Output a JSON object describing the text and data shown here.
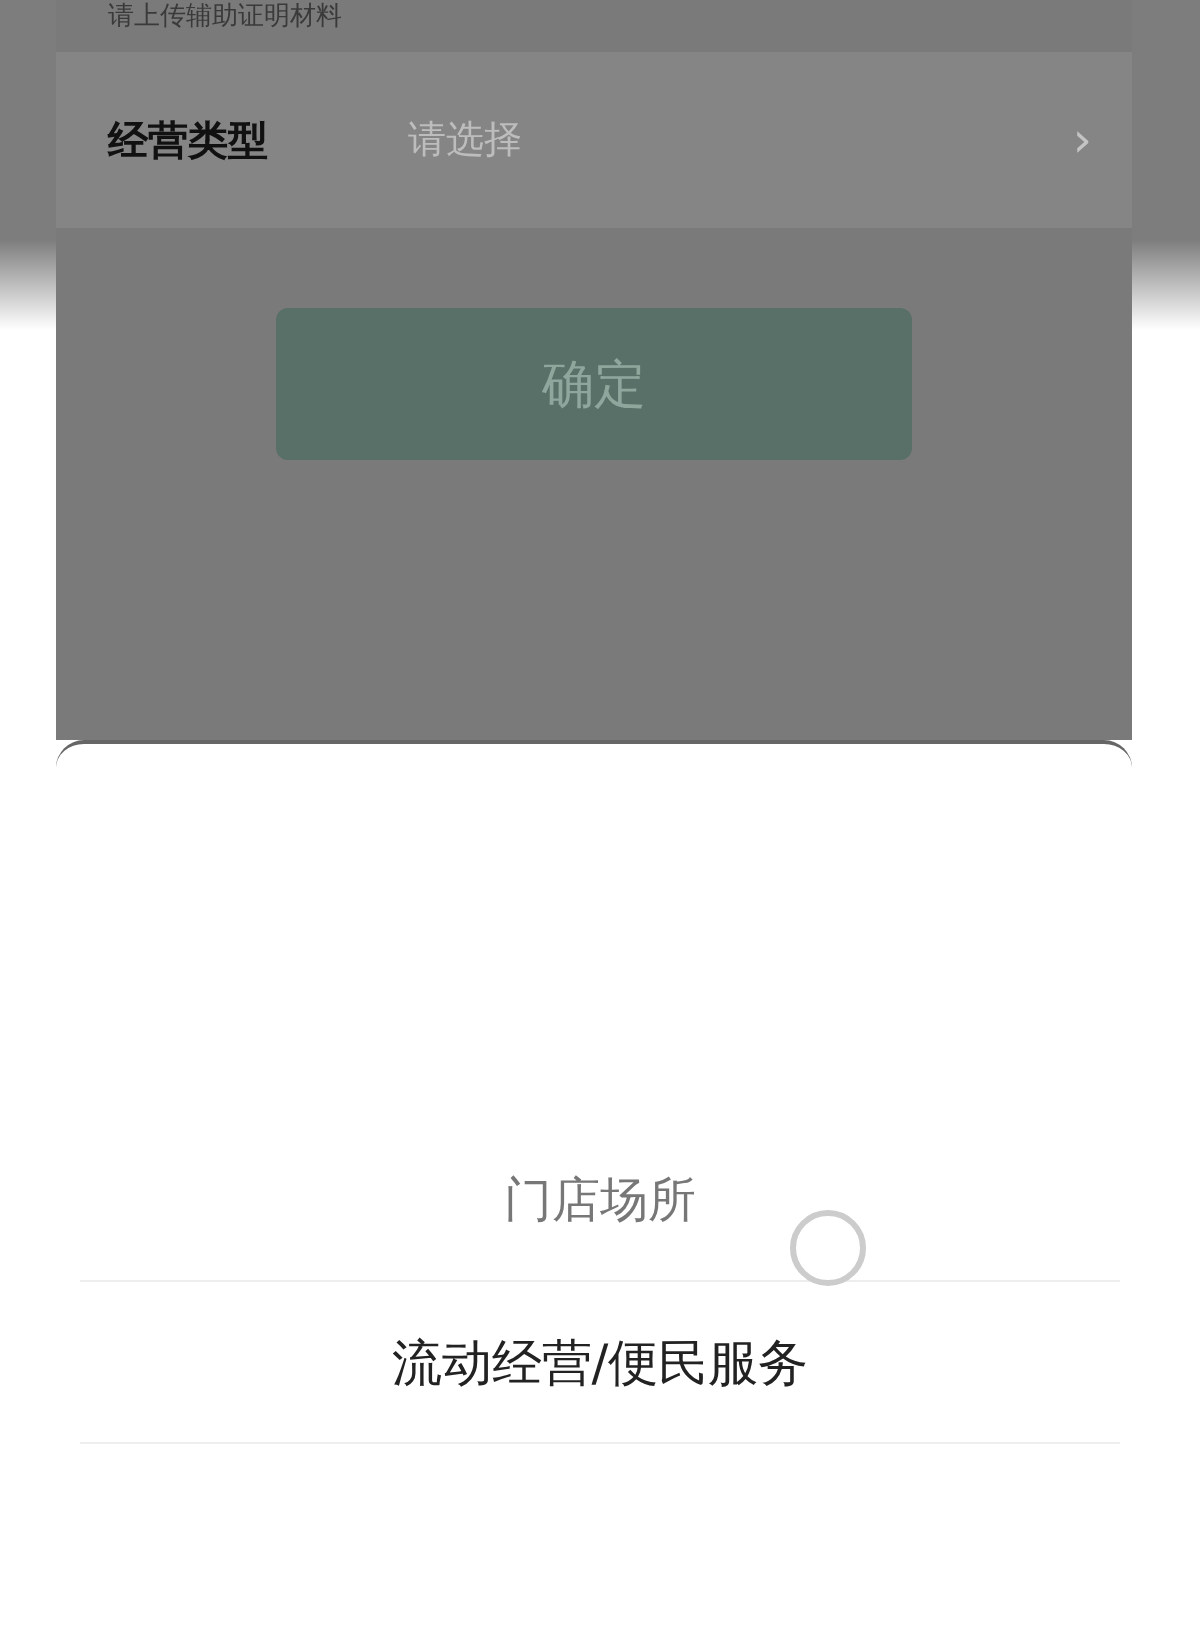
{
  "background_form": {
    "hint": "请上传辅助证明材料",
    "field": {
      "label": "经营类型",
      "placeholder": "请选择",
      "chevron": "›"
    },
    "confirm_button": "确定"
  },
  "picker": {
    "options": [
      {
        "label": "门店场所",
        "selected": false
      },
      {
        "label": "流动经营/便民服务",
        "selected": true
      }
    ]
  }
}
